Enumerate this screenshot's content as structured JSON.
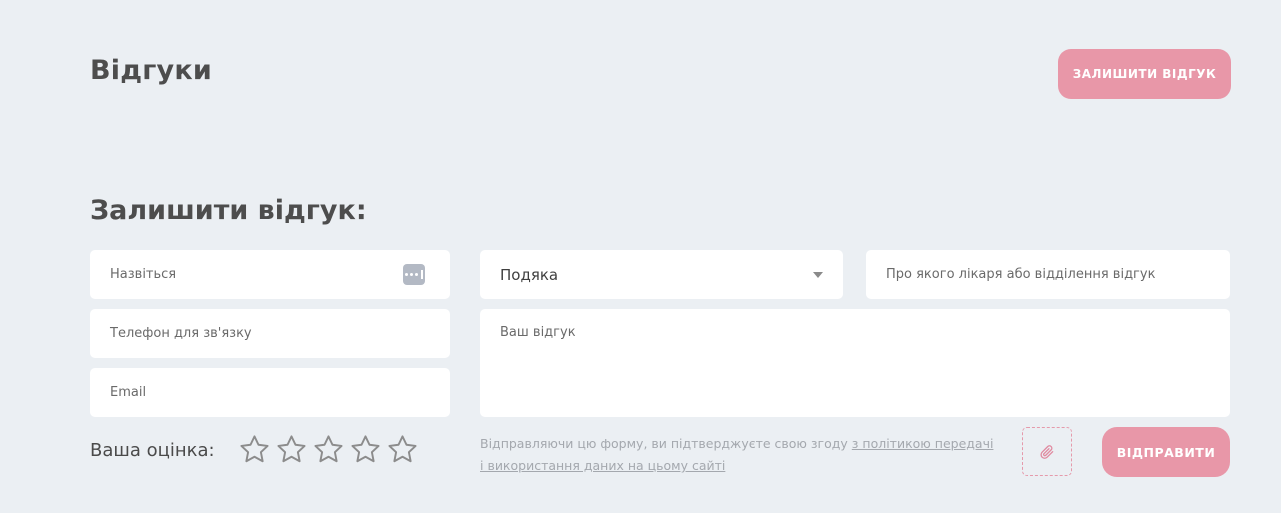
{
  "header": {
    "title": "Відгуки",
    "leave_review_button": "ЗАЛИШИТИ ВІДГУК"
  },
  "form": {
    "title": "Залишити відгук:",
    "fields": {
      "name_placeholder": "Назвіться",
      "phone_placeholder": "Телефон для зв'язку",
      "email_placeholder": "Email",
      "type_selected": "Подяка",
      "doctor_placeholder": "Про якого лікаря або відділення відгук",
      "review_placeholder": "Ваш відгук"
    },
    "rating": {
      "label": "Ваша оцінка:",
      "max": 5,
      "value": 0
    },
    "consent": {
      "text": "Відправляючи цю форму, ви підтверджуєте свою згоду ",
      "link": "з політикою передачі і використання даних на цьому сайті"
    },
    "send_button": "ВІДПРАВИТИ"
  },
  "colors": {
    "background": "#ebeff3",
    "accent": "#e897a8",
    "star_outline": "#8c8c8c"
  },
  "icons": [
    "password-manager-icon",
    "chevron-down-icon",
    "star-icon",
    "paperclip-icon"
  ]
}
